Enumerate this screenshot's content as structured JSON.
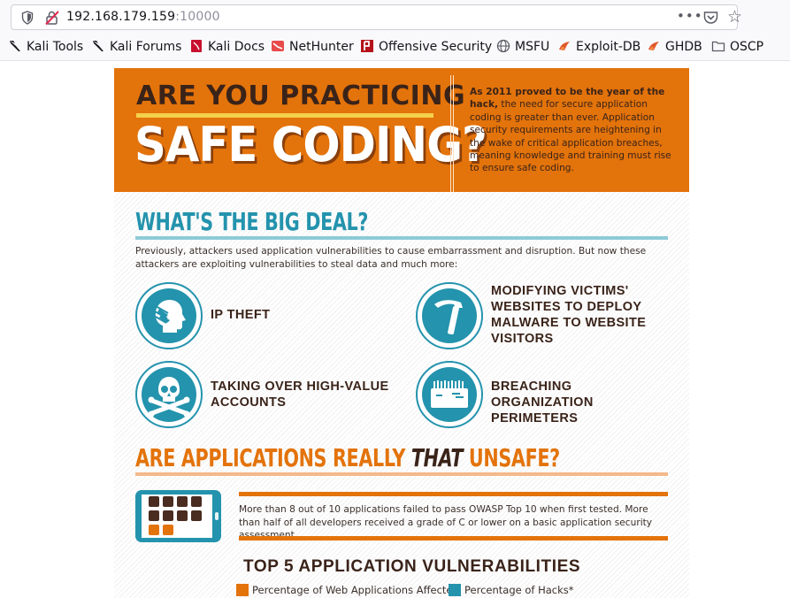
{
  "browser": {
    "url_host": "192.168.179.159",
    "url_port": ":10000",
    "more_label": "•••",
    "star_label": "☆"
  },
  "bookmarks": [
    {
      "label": "Kali Tools",
      "icon": "kali-dragon-icon"
    },
    {
      "label": "Kali Forums",
      "icon": "kali-dragon-icon"
    },
    {
      "label": "Kali Docs",
      "icon": "kali-docs-icon"
    },
    {
      "label": "NetHunter",
      "icon": "nethunter-icon"
    },
    {
      "label": "Offensive Security",
      "icon": "offsec-icon"
    },
    {
      "label": "MSFU",
      "icon": "globe-icon"
    },
    {
      "label": "Exploit-DB",
      "icon": "exploitdb-icon"
    },
    {
      "label": "GHDB",
      "icon": "exploitdb-icon"
    },
    {
      "label": "OSCP",
      "icon": "folder-icon"
    }
  ],
  "infographic": {
    "banner": {
      "line1": "ARE YOU PRACTICING",
      "line2": "SAFE CODING?",
      "intro_bold": "As 2011 proved to be the year of the hack,",
      "intro_rest": " the need for secure application coding is greater than ever. Application security requirements are heightening in the wake of critical application breaches, meaning knowledge and training must rise to ensure safe coding."
    },
    "big_deal": {
      "heading": "WHAT'S THE BIG DEAL?",
      "intro": "Previously, attackers used application vulnerabilities to cause embarrassment and disruption. But now these attackers are exploiting vulnerabilities to steal data and much more:",
      "threats": [
        {
          "label": "IP THEFT",
          "icon": "head-hand-icon"
        },
        {
          "label": "MODIFYING VICTIMS' WEBSITES TO DEPLOY MALWARE TO WEBSITE VISITORS",
          "icon": "hammer-icon"
        },
        {
          "label": "TAKING OVER HIGH-VALUE ACCOUNTS",
          "icon": "skull-crossbones-icon"
        },
        {
          "label": "BREACHING ORGANIZATION PERIMETERS",
          "icon": "wall-icon"
        }
      ]
    },
    "unsafe": {
      "heading_pre": "ARE APPLICATIONS REALLY ",
      "heading_em": "THAT",
      "heading_post": " UNSAFE?",
      "stat": "More than 8 out of 10 applications failed to pass OWASP Top 10 when first tested. More than half of all developers received a grade of C or lower on a basic application security assessment.",
      "tablet_failed": 8,
      "tablet_total": 10
    },
    "top5": {
      "heading": "TOP 5 APPLICATION VULNERABILITIES",
      "legend": [
        {
          "label": "Percentage of Web Applications Affected",
          "color": "#e3730b"
        },
        {
          "label": "Percentage of Hacks*",
          "color": "#2493ad"
        }
      ]
    }
  }
}
